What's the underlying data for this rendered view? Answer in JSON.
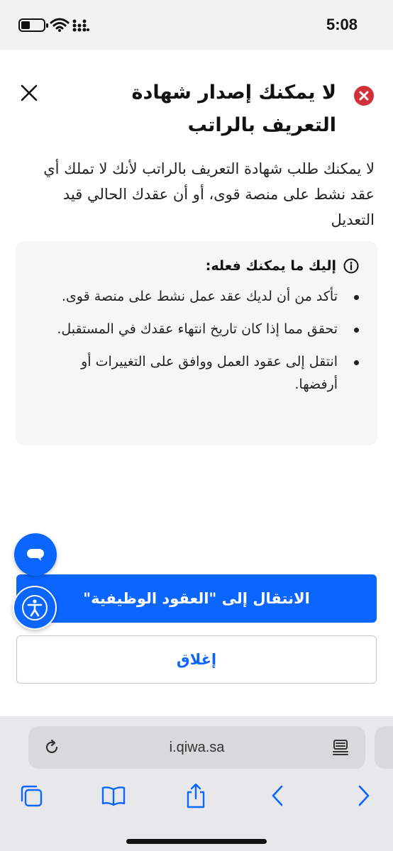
{
  "status": {
    "time": "5:08"
  },
  "dialog": {
    "title": "لا يمكنك إصدار شهادة التعريف بالراتب",
    "description": "لا يمكنك طلب شهادة التعريف بالراتب لأنك لا تملك أي عقد نشط على منصة قوى، أو أن عقدك الحالي قيد التعديل",
    "info_heading": "إليك ما يمكنك فعله:",
    "tips": [
      "تأكد من أن لديك عقد عمل نشط على منصة قوى.",
      "تحقق مما إذا كان تاريخ انتهاء عقدك في المستقبل.",
      "انتقل إلى عقود العمل ووافق على التغييرات أو أرفضها."
    ],
    "primary_button": "الانتقال إلى \"العقود الوظيفية\"",
    "secondary_button": "إغلاق"
  },
  "browser": {
    "url": "i.qiwa.sa"
  },
  "colors": {
    "accent": "#0a66ff",
    "error": "#d32f3a"
  },
  "icons": [
    "close-icon",
    "error-icon",
    "info-icon",
    "chat-icon",
    "accessibility-icon",
    "reload-icon",
    "reader-icon",
    "tabs-icon",
    "bookmarks-icon",
    "share-icon",
    "back-icon",
    "forward-icon"
  ]
}
